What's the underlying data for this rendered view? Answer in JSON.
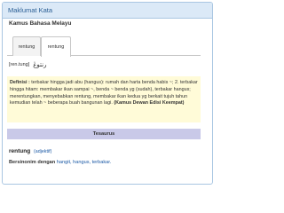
{
  "panel": {
    "title": "Maklumat Kata"
  },
  "dictionary": {
    "name": "Kamus Bahasa Melayu"
  },
  "tabs": [
    {
      "label": "rentung"
    },
    {
      "label": "rentung"
    }
  ],
  "entry": {
    "rumi": "[ren.tung]",
    "jawi": "رنتوڠ"
  },
  "definition": {
    "label": "Definisi :",
    "text": "terbakar hingga jadi abu (hangus): rumah dan harta benda habis ~; 2. terbakar hingga hitam: membakar ikan sampai ~, benda ~ benda yg (sudah), terbakar hangus; merentungkan, menyebabkan rentung, membakar ikan kedua yg berkait tujuh tahun kemudian telah ~ beberapa buah bangunan lagi.",
    "source": "(Kamus Dewan Edisi Keempat)"
  },
  "tesaurus": {
    "header": "Tesaurus",
    "word": "rentung",
    "pos": "(adjektif)",
    "synonym_label": "Bersinonim dengan",
    "synonyms": [
      "hangit,",
      "hangus,",
      "terbakar."
    ]
  },
  "colors": {
    "panel_header": "#dbe9f7",
    "definition_bg": "#fffbd8",
    "tesaurus_header": "#c9c9e8",
    "link": "#1c5aa6"
  }
}
